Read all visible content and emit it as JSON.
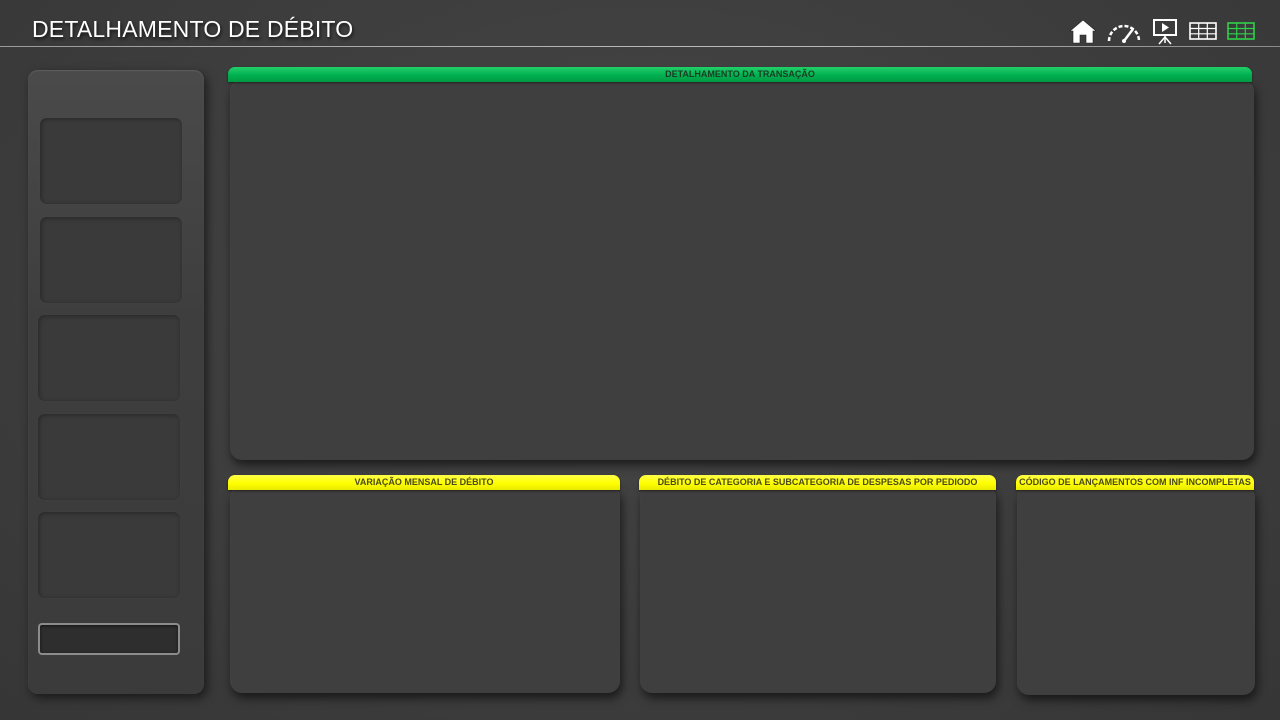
{
  "header": {
    "title": "DETALHAMENTO DE DÉBITO",
    "nav_icons": [
      "home-icon",
      "dashboard-gauge-icon",
      "presentation-icon",
      "table-icon",
      "table-active-icon"
    ],
    "active_color": "#00b050"
  },
  "sidebar": {
    "slots": 5,
    "button_label": ""
  },
  "panels": {
    "transaction": {
      "title": "DETALHAMENTO DA TRANSAÇÃO",
      "color": "#00b050"
    },
    "monthly": {
      "title": "VARIAÇÃO MENSAL DE DÉBITO",
      "color": "#ffff00"
    },
    "category": {
      "title": "DÉBITO  DE CATEGORIA E SUBCATEGORIA DE DESPESAS POR PEDIODO",
      "color": "#ffff00"
    },
    "incomplete": {
      "title": "CÓDIGO DE LANÇAMENTOS COM INF INCOMPLETAS",
      "color": "#ffff00"
    }
  }
}
